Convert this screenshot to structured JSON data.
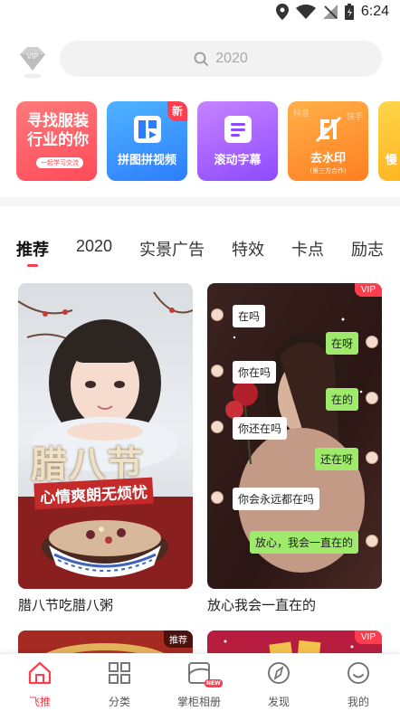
{
  "status_bar": {
    "time": "6:24"
  },
  "header": {
    "vip_label": "VIP",
    "search_placeholder": "2020"
  },
  "features": [
    {
      "lines": [
        "寻找服装",
        "行业的你"
      ],
      "pill": "一起学习交流",
      "icon": "text-banner"
    },
    {
      "label": "拼图拼视频",
      "badge": "新",
      "icon": "collage-icon"
    },
    {
      "label": "滚动字幕",
      "icon": "subtitle-icon"
    },
    {
      "label": "去水印",
      "sub": "(第三方合作)",
      "watermarks": [
        "抖音",
        "快手"
      ],
      "icon": "watermark-icon"
    },
    {
      "label": "慢",
      "icon": "partial-card"
    }
  ],
  "tabs": [
    "推荐",
    "2020",
    "实景广告",
    "特效",
    "卡点",
    "励志"
  ],
  "active_tab": 0,
  "cards": [
    {
      "caption": "腊八节吃腊八粥",
      "headline": "腊八节",
      "tagline": "心情爽朗无烦忧",
      "badge": ""
    },
    {
      "caption": "放心我会一直在的",
      "badge": "VIP",
      "chat": [
        {
          "side": "left",
          "text": "在吗"
        },
        {
          "side": "right",
          "text": "在呀"
        },
        {
          "side": "left",
          "text": "你在吗"
        },
        {
          "side": "right",
          "text": "在的"
        },
        {
          "side": "left",
          "text": "你还在吗"
        },
        {
          "side": "right",
          "text": "还在呀"
        },
        {
          "side": "left",
          "text": "你会永远都在吗"
        },
        {
          "side": "right",
          "text": "放心，我会一直在的"
        }
      ]
    },
    {
      "caption": "",
      "badge": "推荐"
    },
    {
      "caption": "",
      "badge": "VIP"
    }
  ],
  "bottom_nav": [
    {
      "label": "飞推",
      "icon": "home-icon",
      "active": true
    },
    {
      "label": "分类",
      "icon": "grid-icon",
      "active": false
    },
    {
      "label": "掌柜相册",
      "icon": "album-icon",
      "active": false,
      "badge": "NEW"
    },
    {
      "label": "发现",
      "icon": "compass-icon",
      "active": false
    },
    {
      "label": "我的",
      "icon": "smile-icon",
      "active": false
    }
  ],
  "colors": {
    "accent": "#ff3d4d",
    "chat_green": "#9eea6a"
  }
}
